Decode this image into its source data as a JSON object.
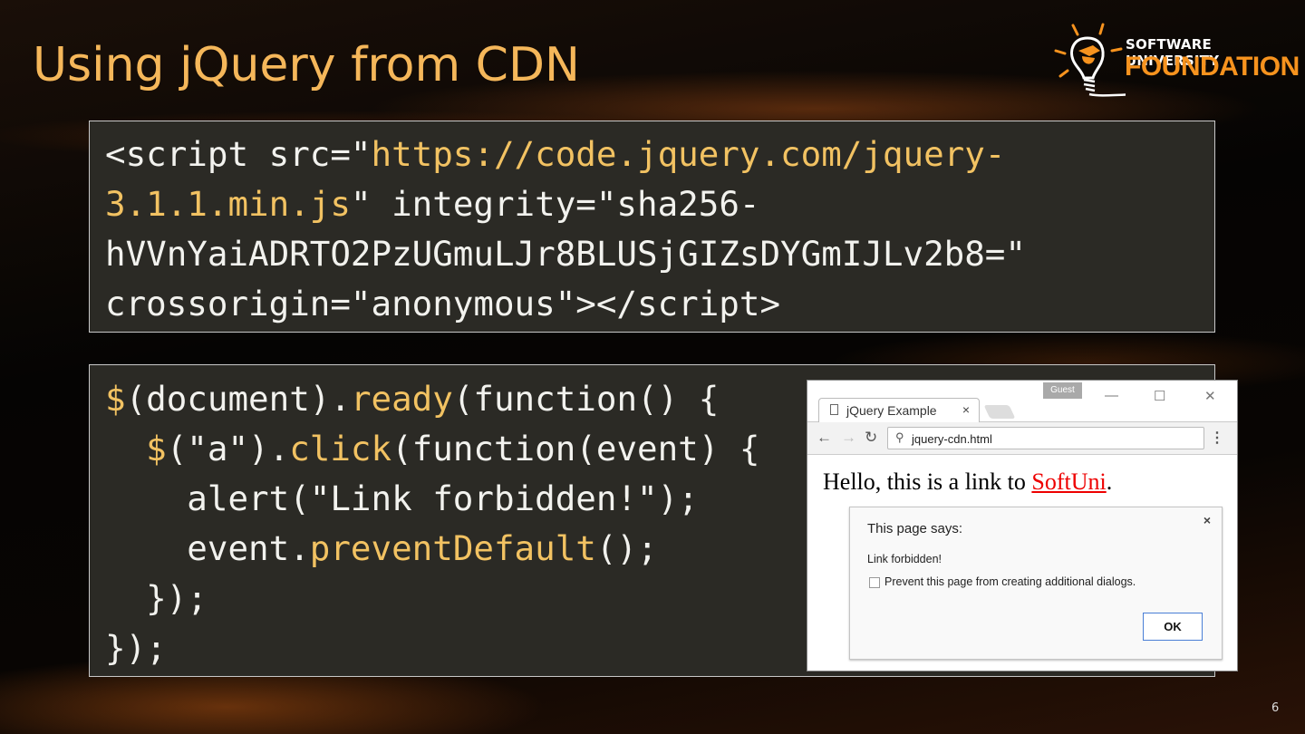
{
  "slide": {
    "title": "Using jQuery from CDN",
    "page_number": "6"
  },
  "logo": {
    "line1": "SOFTWARE UNIVERSITY",
    "line2": "FOUNDATION"
  },
  "code_block_1": [
    [
      {
        "t": "<script src=\""
      },
      {
        "t": "https://code.jquery.com/jquery-",
        "y": 1
      }
    ],
    [
      {
        "t": "3.1.1.min.js",
        "y": 1
      },
      {
        "t": "\" integrity=\"sha256-"
      }
    ],
    [
      {
        "t": "hVVnYaiADRTO2PzUGmuLJr8BLUSjGIZsDYGmIJLv2b8=\""
      }
    ],
    [
      {
        "t": "crossorigin=\"anonymous\"></script>"
      }
    ]
  ],
  "code_block_2": [
    [
      {
        "t": "$",
        "y": 1
      },
      {
        "t": "(document)."
      },
      {
        "t": "ready",
        "y": 1
      },
      {
        "t": "(function() {"
      }
    ],
    [
      {
        "t": "  "
      },
      {
        "t": "$",
        "y": 1
      },
      {
        "t": "(\"a\")."
      },
      {
        "t": "click",
        "y": 1
      },
      {
        "t": "(function(event) {"
      }
    ],
    [
      {
        "t": "    alert(\"Link forbidden!\");"
      }
    ],
    [
      {
        "t": "    event."
      },
      {
        "t": "preventDefault",
        "y": 1
      },
      {
        "t": "();"
      }
    ],
    [
      {
        "t": "  });"
      }
    ],
    [
      {
        "t": "});"
      }
    ]
  ],
  "browser": {
    "guest_label": "Guest",
    "tab_title": "jQuery Example",
    "tab_close": "×",
    "address": "jquery-cdn.html",
    "page_text": "Hello, this is a link to ",
    "link_text": "SoftUni",
    "page_text_end": ".",
    "dialog": {
      "heading": "This page says:",
      "message": "Link forbidden!",
      "checkbox_label": "Prevent this page from creating additional dialogs.",
      "close": "×",
      "ok_label": "OK"
    }
  },
  "colors": {
    "title": "#f5b75a",
    "code_yellow": "#f2c262",
    "code_bg": "#2b2a25",
    "link": "#ee0000"
  }
}
